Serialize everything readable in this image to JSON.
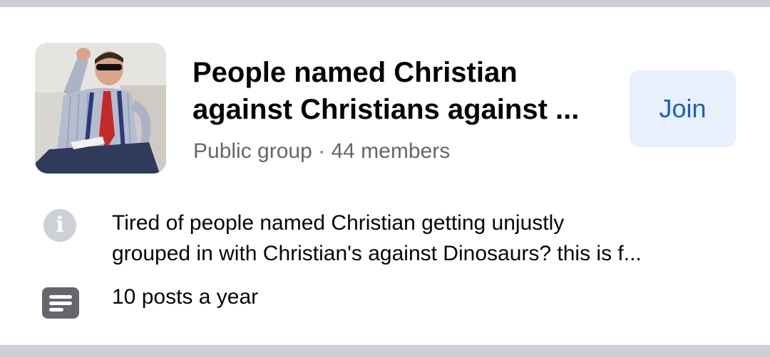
{
  "group": {
    "title_lines": [
      "People named Christian",
      "against Christians against ..."
    ],
    "privacy": "Public group",
    "separator": "·",
    "member_count": "44 members",
    "join_label": "Join",
    "thumbnail": "group-photo-man-in-suit-red-tie-sunglasses"
  },
  "details": {
    "description_lines": [
      "Tired of people named Christian getting unjustly",
      "grouped in with Christian's against Dinosaurs? this is f..."
    ],
    "info_icon": "info-icon",
    "info_glyph": "i",
    "activity_icon": "posts-icon",
    "activity": "10 posts a year"
  },
  "colors": {
    "accent": "#1b5fc5",
    "button_bg": "#e7f0fb",
    "secondary_text": "#65676b",
    "divider": "#ccd0d5"
  }
}
